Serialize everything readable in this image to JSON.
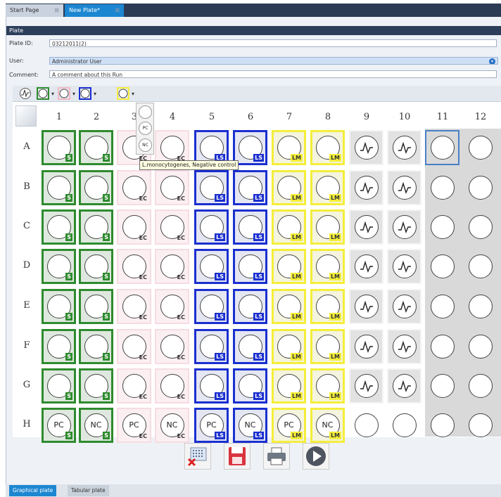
{
  "tabs": [
    {
      "label": "Start Page",
      "close": "⊠"
    },
    {
      "label": "New Plate*",
      "close": "⊠"
    }
  ],
  "section_title": "Plate",
  "fields": {
    "plate_id_label": "Plate ID:",
    "plate_id_value": "03212011(2)",
    "user_label": "User:",
    "user_value": "Administrator User",
    "comment_label": "Comment:",
    "comment_value": "A comment about this Run"
  },
  "toolbar_icons": [
    "waveform-icon",
    "well-green-icon",
    "well-pink-icon",
    "well-blue-icon",
    "well-yellow-icon"
  ],
  "popup_items": [
    "",
    "PC",
    "NC"
  ],
  "tooltip": "L.monocytogenes, Negative control",
  "columns": [
    "1",
    "2",
    "3",
    "4",
    "5",
    "6",
    "7",
    "8",
    "9",
    "10",
    "11",
    "12"
  ],
  "rows": [
    "A",
    "B",
    "C",
    "D",
    "E",
    "F",
    "G",
    "H"
  ],
  "column_groups": {
    "1": {
      "color": "green",
      "badge": "S"
    },
    "2": {
      "color": "green",
      "badge": "S"
    },
    "3": {
      "color": "pink",
      "badge": "EC"
    },
    "4": {
      "color": "pink",
      "badge": "EC"
    },
    "5": {
      "color": "blue",
      "badge": "LS"
    },
    "6": {
      "color": "blue",
      "badge": "LS"
    },
    "7": {
      "color": "yellow",
      "badge": "LM"
    },
    "8": {
      "color": "yellow",
      "badge": "LM"
    },
    "9": {
      "color": "grey",
      "badge": ""
    },
    "10": {
      "color": "grey",
      "badge": ""
    },
    "11": {
      "color": "none",
      "badge": ""
    },
    "12": {
      "color": "none",
      "badge": ""
    }
  },
  "row_H_labels": [
    "PC",
    "NC",
    "PC",
    "NC",
    "PC",
    "NC",
    "PC",
    "NC",
    "",
    "",
    "",
    ""
  ],
  "colors": {
    "green": "#2e8b2e",
    "pink": "#f3b8c4",
    "blue": "#1a2fd0",
    "yellow": "#f4ee3a",
    "grey": "#e2e2e2",
    "selected": "#4a7fc8"
  },
  "actions": [
    {
      "name": "clear-plate-button",
      "icon": "grid-clear-icon"
    },
    {
      "name": "save-button",
      "icon": "floppy-icon"
    },
    {
      "name": "print-button",
      "icon": "printer-icon"
    },
    {
      "name": "run-button",
      "icon": "play-icon"
    }
  ],
  "bottom_tabs": [
    "Graphical plate",
    "Tabular plate"
  ]
}
